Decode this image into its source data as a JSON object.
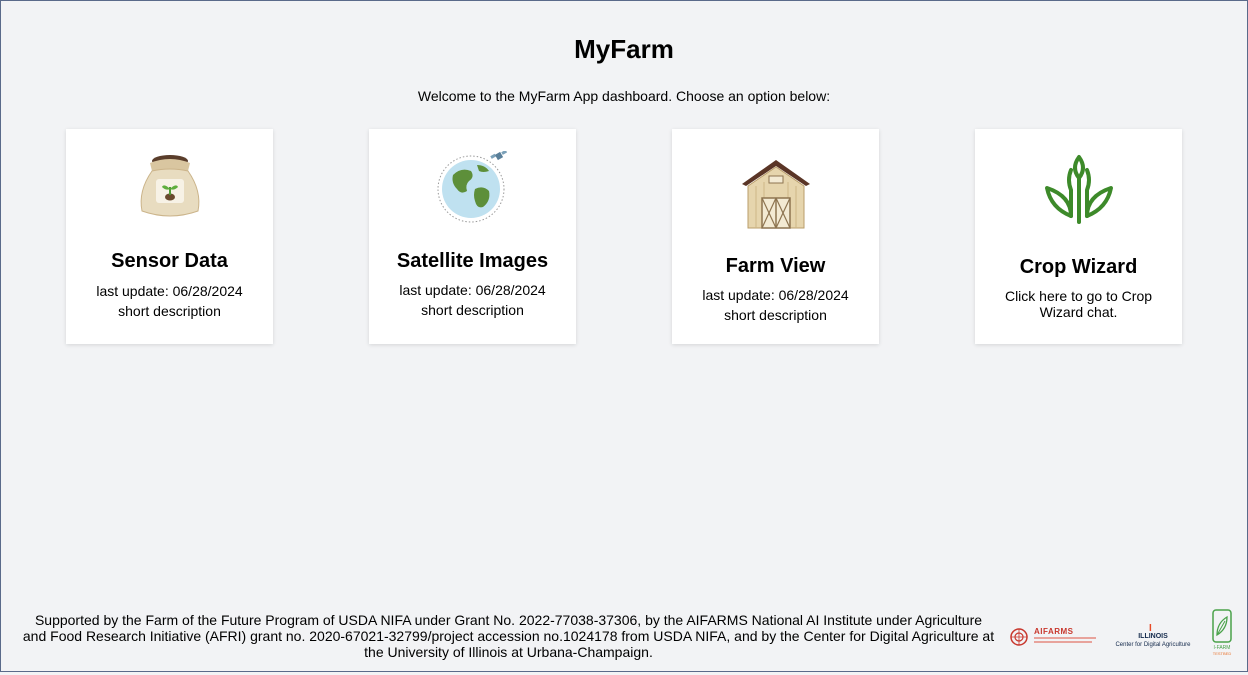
{
  "header": {
    "title": "MyFarm",
    "subtitle": "Welcome to the MyFarm App dashboard. Choose an option below:"
  },
  "cards": [
    {
      "title": "Sensor Data",
      "line1": "last update: 06/28/2024",
      "line2": "short description",
      "icon": "seed-bag-icon"
    },
    {
      "title": "Satellite Images",
      "line1": "last update: 06/28/2024",
      "line2": "short description",
      "icon": "globe-satellite-icon"
    },
    {
      "title": "Farm View",
      "line1": "last update: 06/28/2024",
      "line2": "short description",
      "icon": "barn-icon"
    },
    {
      "title": "Crop Wizard",
      "line1": "Click here to go to Crop",
      "line2": "Wizard chat.",
      "icon": "sprout-icon"
    }
  ],
  "footer": {
    "text_line1": "Supported by the Farm of the Future Program of USDA NIFA under Grant No. 2022-77038-37306, by the AIFARMS National AI Institute under Agriculture",
    "text_line2": "and Food Research Initiative (AFRI) grant no. 2020-67021-32799/project accession no.1024178 from USDA NIFA, and by the Center for Digital Agriculture at",
    "text_line3": "the University of Illinois at Urbana-Champaign.",
    "logos": {
      "aifarms": "AIFARMS",
      "illinois": "ILLINOIS",
      "illinois_sub": "Center for Digital Agriculture",
      "ifarm": "I-FARM",
      "ifarm_sub": "TESTBED"
    }
  },
  "colors": {
    "background": "#f2f3f5",
    "card": "#ffffff",
    "leaf_green": "#3d8a2a",
    "aifarms_red": "#c8372d",
    "illinois_blue": "#13294b"
  }
}
